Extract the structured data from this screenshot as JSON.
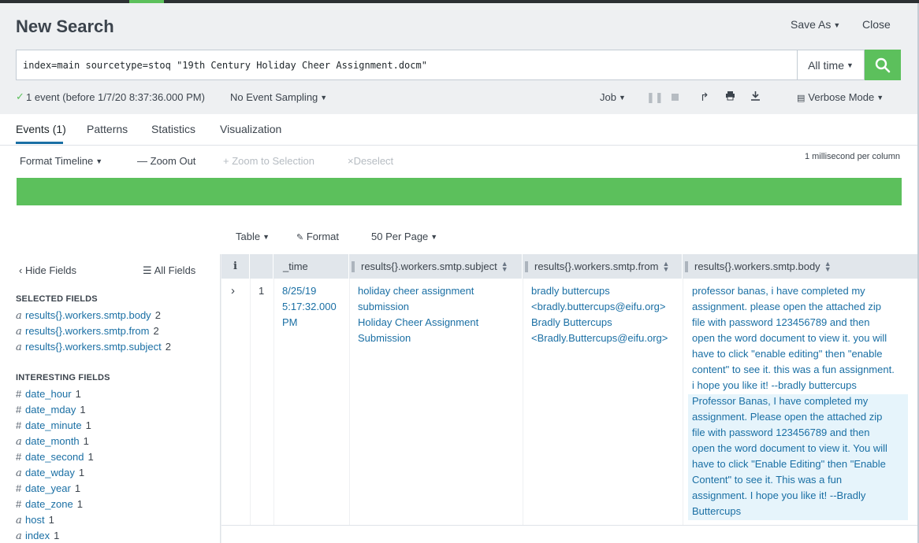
{
  "header": {
    "title": "New Search",
    "save_as": "Save As",
    "close": "Close"
  },
  "search": {
    "query": "index=main sourcetype=stoq \"19th Century Holiday Cheer Assignment.docm\"",
    "time_range": "All time"
  },
  "status": {
    "events_summary": "1 event (before 1/7/20 8:37:36.000 PM)",
    "sampling": "No Event Sampling",
    "job": "Job",
    "mode": "Verbose Mode"
  },
  "tabs": [
    {
      "label": "Events (1)"
    },
    {
      "label": "Patterns"
    },
    {
      "label": "Statistics"
    },
    {
      "label": "Visualization"
    }
  ],
  "timeline": {
    "format": "Format Timeline",
    "zoom_out": "Zoom Out",
    "zoom_selection": "Zoom to Selection",
    "deselect": "Deselect",
    "scale": "1 millisecond per column"
  },
  "table_controls": {
    "view": "Table",
    "format": "Format",
    "per_page": "50 Per Page"
  },
  "sidebar": {
    "hide_fields": "Hide Fields",
    "all_fields": "All Fields",
    "selected_title": "SELECTED FIELDS",
    "selected": [
      {
        "type": "a",
        "name": "results{}.workers.smtp.body",
        "count": "2"
      },
      {
        "type": "a",
        "name": "results{}.workers.smtp.from",
        "count": "2"
      },
      {
        "type": "a",
        "name": "results{}.workers.smtp.subject",
        "count": "2"
      }
    ],
    "interesting_title": "INTERESTING FIELDS",
    "interesting": [
      {
        "type": "#",
        "name": "date_hour",
        "count": "1"
      },
      {
        "type": "#",
        "name": "date_mday",
        "count": "1"
      },
      {
        "type": "#",
        "name": "date_minute",
        "count": "1"
      },
      {
        "type": "a",
        "name": "date_month",
        "count": "1"
      },
      {
        "type": "#",
        "name": "date_second",
        "count": "1"
      },
      {
        "type": "a",
        "name": "date_wday",
        "count": "1"
      },
      {
        "type": "#",
        "name": "date_year",
        "count": "1"
      },
      {
        "type": "#",
        "name": "date_zone",
        "count": "1"
      },
      {
        "type": "a",
        "name": "host",
        "count": "1"
      },
      {
        "type": "a",
        "name": "index",
        "count": "1"
      }
    ]
  },
  "table": {
    "columns": [
      "i",
      "_time",
      "results{}.workers.smtp.subject",
      "results{}.workers.smtp.from",
      "results{}.workers.smtp.body"
    ],
    "rows": [
      {
        "num": "1",
        "time": [
          "8/25/19",
          "5:17:32.000",
          "PM"
        ],
        "subject": [
          "holiday cheer assignment",
          "submission",
          "Holiday Cheer Assignment",
          "Submission"
        ],
        "from": [
          "bradly buttercups",
          "<bradly.buttercups@eifu.org>",
          "Bradly Buttercups",
          "<Bradly.Buttercups@eifu.org>"
        ],
        "body": [
          "professor banas, i have completed my",
          "assignment. please open the attached zip",
          "file with password 123456789 and then",
          "open the word document to view it. you will",
          "have to click \"enable editing\" then \"enable",
          "content\" to see it. this was a fun assignment.",
          "i hope you like it! --bradly buttercups",
          "Professor Banas, I have completed my",
          "assignment. Please open the attached zip",
          "file with password 123456789 and then",
          "open the word document to view it. You will",
          "have to click \"Enable Editing\" then \"Enable",
          "Content\" to see it. This was a fun",
          "assignment. I hope you like it! --Bradly",
          "Buttercups"
        ]
      }
    ]
  },
  "colors": {
    "accent_green": "#5cc05c",
    "link_blue": "#1a6fa4",
    "highlight": "#e6f4fb"
  }
}
